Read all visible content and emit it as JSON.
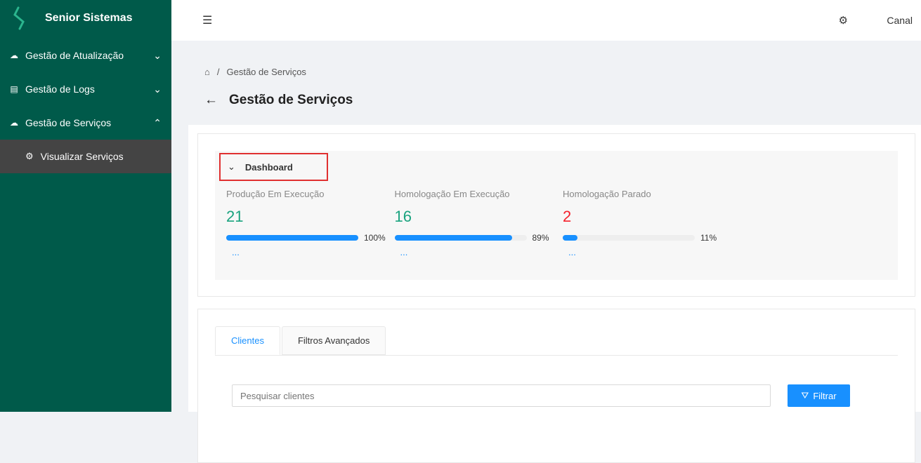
{
  "app": {
    "title": "Senior Sistemas"
  },
  "sidebar": {
    "items": [
      {
        "label": "Gestão de Atualização",
        "icon": "cloud-upload-icon",
        "chevron": "⌄"
      },
      {
        "label": "Gestão de Logs",
        "icon": "file-search-icon",
        "chevron": "⌄"
      },
      {
        "label": "Gestão de Serviços",
        "icon": "cloud-sync-icon",
        "chevron": "⌃"
      }
    ],
    "sub_item": {
      "label": "Visualizar Serviços",
      "icon": "gear-icon"
    }
  },
  "header": {
    "user": "Canal"
  },
  "breadcrumb": {
    "sep": "/",
    "current": "Gestão de Serviços"
  },
  "page": {
    "title": "Gestão de Serviços"
  },
  "dashboard": {
    "title": "Dashboard",
    "stats": [
      {
        "label": "Produção Em Execução",
        "value": "21",
        "percent_label": "100%",
        "percent": 100,
        "color": "#1aa37f"
      },
      {
        "label": "Homologação Em Execução",
        "value": "16",
        "percent_label": "89%",
        "percent": 89,
        "color": "#1aa37f"
      },
      {
        "label": "Homologação Parado",
        "value": "2",
        "percent_label": "11%",
        "percent": 11,
        "color": "#f5222d"
      }
    ],
    "more": "..."
  },
  "tabs": [
    {
      "label": "Clientes"
    },
    {
      "label": "Filtros Avançados"
    }
  ],
  "search": {
    "placeholder": "Pesquisar clientes",
    "value": ""
  },
  "filter_button": {
    "label": "Filtrar"
  }
}
